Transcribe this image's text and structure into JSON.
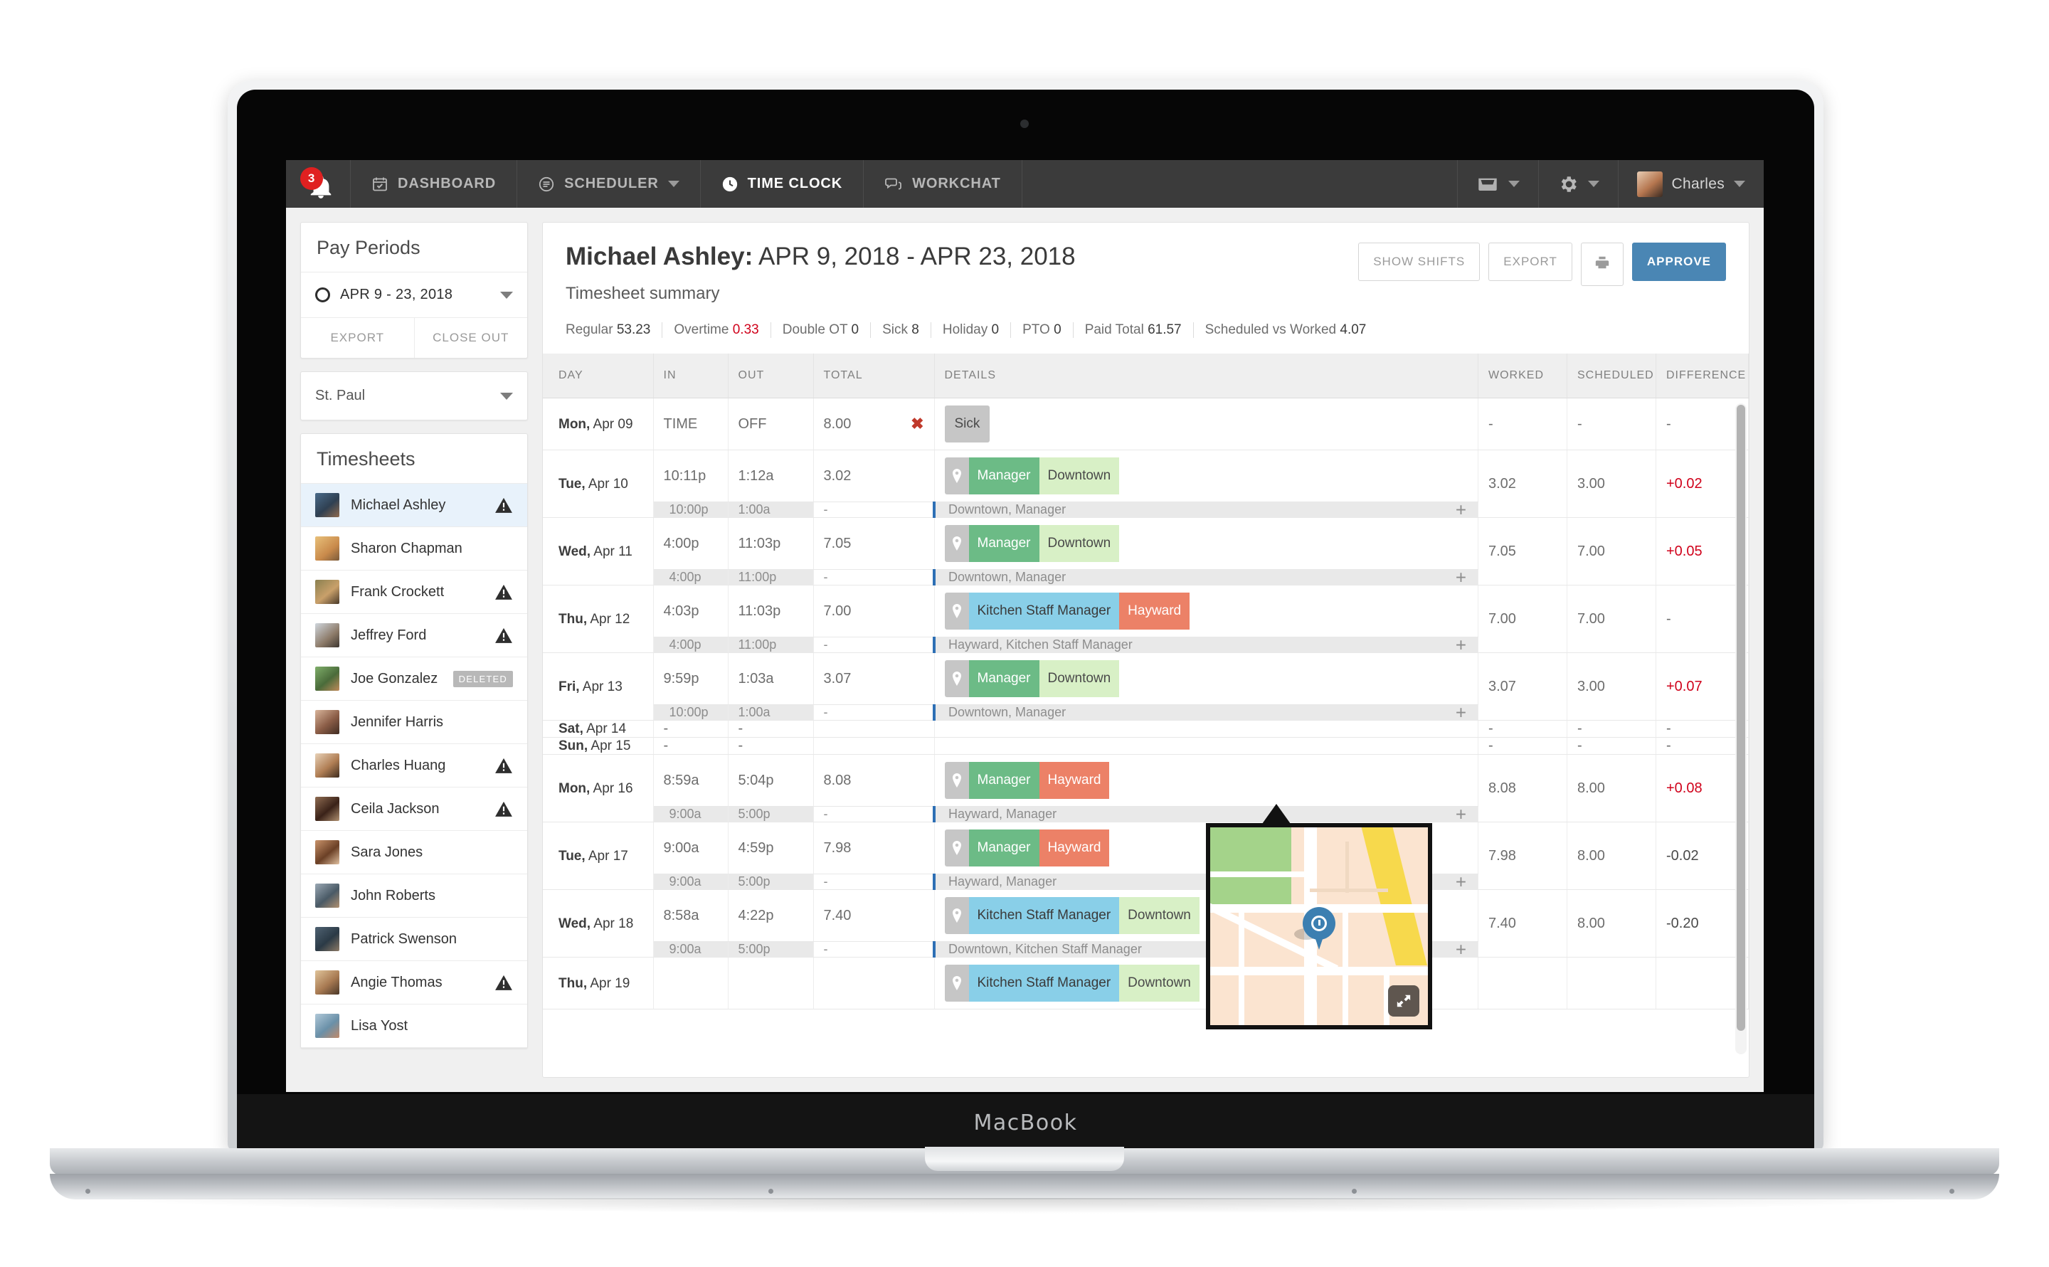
{
  "device": {
    "brand_label": "MacBook"
  },
  "topnav": {
    "notifications": {
      "count": "3",
      "icon": "bell-icon"
    },
    "items": [
      {
        "label": "DASHBOARD",
        "icon": "calendar-check-icon",
        "active": false,
        "has_caret": false
      },
      {
        "label": "SCHEDULER",
        "icon": "list-icon",
        "active": false,
        "has_caret": true
      },
      {
        "label": "TIME CLOCK",
        "icon": "clock-icon",
        "active": true,
        "has_caret": false
      },
      {
        "label": "WORKCHAT",
        "icon": "chat-bubbles-icon",
        "active": false,
        "has_caret": false
      }
    ],
    "right": {
      "inbox_icon": "inbox-tray-icon",
      "settings_icon": "gear-icon",
      "user_name": "Charles"
    }
  },
  "sidebar": {
    "pay_periods": {
      "title": "Pay Periods",
      "selected_period": "APR 9 - 23, 2018",
      "status_icon": "open-circle-icon",
      "export_label": "EXPORT",
      "close_out_label": "CLOSE OUT"
    },
    "location": {
      "value": "St. Paul"
    },
    "timesheets": {
      "title": "Timesheets",
      "people": [
        {
          "name": "Michael Ashley",
          "selected": true,
          "warning": true,
          "badge": ""
        },
        {
          "name": "Sharon Chapman",
          "selected": false,
          "warning": false,
          "badge": ""
        },
        {
          "name": "Frank Crockett",
          "selected": false,
          "warning": true,
          "badge": ""
        },
        {
          "name": "Jeffrey Ford",
          "selected": false,
          "warning": true,
          "badge": ""
        },
        {
          "name": "Joe Gonzalez",
          "selected": false,
          "warning": false,
          "badge": "DELETED"
        },
        {
          "name": "Jennifer Harris",
          "selected": false,
          "warning": false,
          "badge": ""
        },
        {
          "name": "Charles Huang",
          "selected": false,
          "warning": true,
          "badge": ""
        },
        {
          "name": "Ceila Jackson",
          "selected": false,
          "warning": true,
          "badge": ""
        },
        {
          "name": "Sara Jones",
          "selected": false,
          "warning": false,
          "badge": ""
        },
        {
          "name": "John Roberts",
          "selected": false,
          "warning": false,
          "badge": ""
        },
        {
          "name": "Patrick Swenson",
          "selected": false,
          "warning": false,
          "badge": ""
        },
        {
          "name": "Angie Thomas",
          "selected": false,
          "warning": true,
          "badge": ""
        },
        {
          "name": "Lisa Yost",
          "selected": false,
          "warning": false,
          "badge": ""
        }
      ]
    }
  },
  "main": {
    "employee_name": "Michael Ashley:",
    "date_range": " APR 9, 2018 - APR 23, 2018",
    "subtitle": "Timesheet summary",
    "actions": {
      "show_shifts": "SHOW SHIFTS",
      "export": "EXPORT",
      "print_icon": "printer-icon",
      "approve": "APPROVE"
    },
    "summary": [
      {
        "label": "Regular",
        "value": "53.23",
        "highlight": false
      },
      {
        "label": "Overtime",
        "value": "0.33",
        "highlight": true
      },
      {
        "label": "Double OT",
        "value": "0",
        "highlight": false
      },
      {
        "label": "Sick",
        "value": "8",
        "highlight": false
      },
      {
        "label": "Holiday",
        "value": "0",
        "highlight": false
      },
      {
        "label": "PTO",
        "value": "0",
        "highlight": false
      },
      {
        "label": "Paid Total",
        "value": "61.57",
        "highlight": false
      },
      {
        "label": "Scheduled vs Worked",
        "value": "4.07",
        "highlight": false
      }
    ],
    "table": {
      "columns": [
        "DAY",
        "IN",
        "OUT",
        "TOTAL",
        "DETAILS",
        "WORKED",
        "SCHEDULED",
        "DIFFERENCE"
      ],
      "rows": [
        {
          "day_dow": "Mon,",
          "day_date": " Apr 09",
          "in": "TIME",
          "out": "OFF",
          "total": "8.00",
          "has_x": true,
          "tags": [
            {
              "text": "Sick",
              "style": "t-sick"
            }
          ],
          "show_pin": false,
          "worked": "-",
          "scheduled": "-",
          "difference": "-",
          "diff_class": "",
          "shift": null
        },
        {
          "day_dow": "Tue,",
          "day_date": " Apr 10",
          "in": "10:11p",
          "out": "1:12a",
          "total": "3.02",
          "has_x": false,
          "tags": [
            {
              "text": "Manager",
              "style": "t-mgr"
            },
            {
              "text": "Downtown",
              "style": "t-dwn"
            }
          ],
          "show_pin": true,
          "worked": "3.02",
          "scheduled": "3.00",
          "difference": "+0.02",
          "diff_class": "diff-pos",
          "shift": {
            "in": "10:00p",
            "out": "1:00a",
            "total": "-",
            "label": "Downtown, Manager"
          }
        },
        {
          "day_dow": "Wed,",
          "day_date": " Apr 11",
          "in": "4:00p",
          "out": "11:03p",
          "total": "7.05",
          "has_x": false,
          "tags": [
            {
              "text": "Manager",
              "style": "t-mgr"
            },
            {
              "text": "Downtown",
              "style": "t-dwn"
            }
          ],
          "show_pin": true,
          "worked": "7.05",
          "scheduled": "7.00",
          "difference": "+0.05",
          "diff_class": "diff-pos",
          "shift": {
            "in": "4:00p",
            "out": "11:00p",
            "total": "-",
            "label": "Downtown, Manager"
          }
        },
        {
          "day_dow": "Thu,",
          "day_date": " Apr 12",
          "in": "4:03p",
          "out": "11:03p",
          "total": "7.00",
          "has_x": false,
          "tags": [
            {
              "text": "Kitchen Staff Manager",
              "style": "t-ksm"
            },
            {
              "text": "Hayward",
              "style": "t-hay"
            }
          ],
          "show_pin": true,
          "worked": "7.00",
          "scheduled": "7.00",
          "difference": "-",
          "diff_class": "",
          "shift": {
            "in": "4:00p",
            "out": "11:00p",
            "total": "-",
            "label": "Hayward, Kitchen Staff Manager"
          }
        },
        {
          "day_dow": "Fri,",
          "day_date": " Apr 13",
          "in": "9:59p",
          "out": "1:03a",
          "total": "3.07",
          "has_x": false,
          "tags": [
            {
              "text": "Manager",
              "style": "t-mgr"
            },
            {
              "text": "Downtown",
              "style": "t-dwn"
            }
          ],
          "show_pin": true,
          "worked": "3.07",
          "scheduled": "3.00",
          "difference": "+0.07",
          "diff_class": "diff-pos",
          "shift": {
            "in": "10:00p",
            "out": "1:00a",
            "total": "-",
            "label": "Downtown, Manager"
          }
        },
        {
          "day_dow": "Sat,",
          "day_date": " Apr 14",
          "in": "-",
          "out": "-",
          "total": "",
          "has_x": false,
          "tags": [],
          "show_pin": false,
          "worked": "-",
          "scheduled": "-",
          "difference": "-",
          "diff_class": "",
          "shift": null
        },
        {
          "day_dow": "Sun,",
          "day_date": " Apr 15",
          "in": "-",
          "out": "-",
          "total": "",
          "has_x": false,
          "tags": [],
          "show_pin": false,
          "worked": "-",
          "scheduled": "-",
          "difference": "-",
          "diff_class": "",
          "shift": null
        },
        {
          "day_dow": "Mon,",
          "day_date": " Apr 16",
          "in": "8:59a",
          "out": "5:04p",
          "total": "8.08",
          "has_x": false,
          "tags": [
            {
              "text": "Manager",
              "style": "t-mgr"
            },
            {
              "text": "Hayward",
              "style": "t-hay"
            }
          ],
          "show_pin": true,
          "worked": "8.08",
          "scheduled": "8.00",
          "difference": "+0.08",
          "diff_class": "diff-pos",
          "shift": {
            "in": "9:00a",
            "out": "5:00p",
            "total": "-",
            "label": "Hayward, Manager"
          }
        },
        {
          "day_dow": "Tue,",
          "day_date": " Apr 17",
          "in": "9:00a",
          "out": "4:59p",
          "total": "7.98",
          "has_x": false,
          "tags": [
            {
              "text": "Manager",
              "style": "t-mgr"
            },
            {
              "text": "Hayward",
              "style": "t-hay"
            }
          ],
          "show_pin": true,
          "worked": "7.98",
          "scheduled": "8.00",
          "difference": "-0.02",
          "diff_class": "diff-neg",
          "shift": {
            "in": "9:00a",
            "out": "5:00p",
            "total": "-",
            "label": "Hayward, Manager"
          }
        },
        {
          "day_dow": "Wed,",
          "day_date": " Apr 18",
          "in": "8:58a",
          "out": "4:22p",
          "total": "7.40",
          "has_x": false,
          "tags": [
            {
              "text": "Kitchen Staff Manager",
              "style": "t-ksm"
            },
            {
              "text": "Downtown",
              "style": "t-dwn"
            }
          ],
          "show_pin": true,
          "worked": "7.40",
          "scheduled": "8.00",
          "difference": "-0.20",
          "diff_class": "diff-neg",
          "shift": {
            "in": "9:00a",
            "out": "5:00p",
            "total": "-",
            "label": "Downtown, Kitchen Staff Manager"
          }
        },
        {
          "day_dow": "Thu,",
          "day_date": " Apr 19",
          "in": "",
          "out": "",
          "total": "",
          "has_x": false,
          "tags": [
            {
              "text": "Kitchen Staff Manager",
              "style": "t-ksm"
            },
            {
              "text": "Downtown",
              "style": "t-dwn"
            }
          ],
          "show_pin": true,
          "worked": "",
          "scheduled": "",
          "difference": "",
          "diff_class": "",
          "shift": null
        }
      ]
    },
    "map_popover": {
      "pin_icon": "clock-map-pin-icon",
      "expand_icon": "expand-arrows-icon"
    }
  }
}
